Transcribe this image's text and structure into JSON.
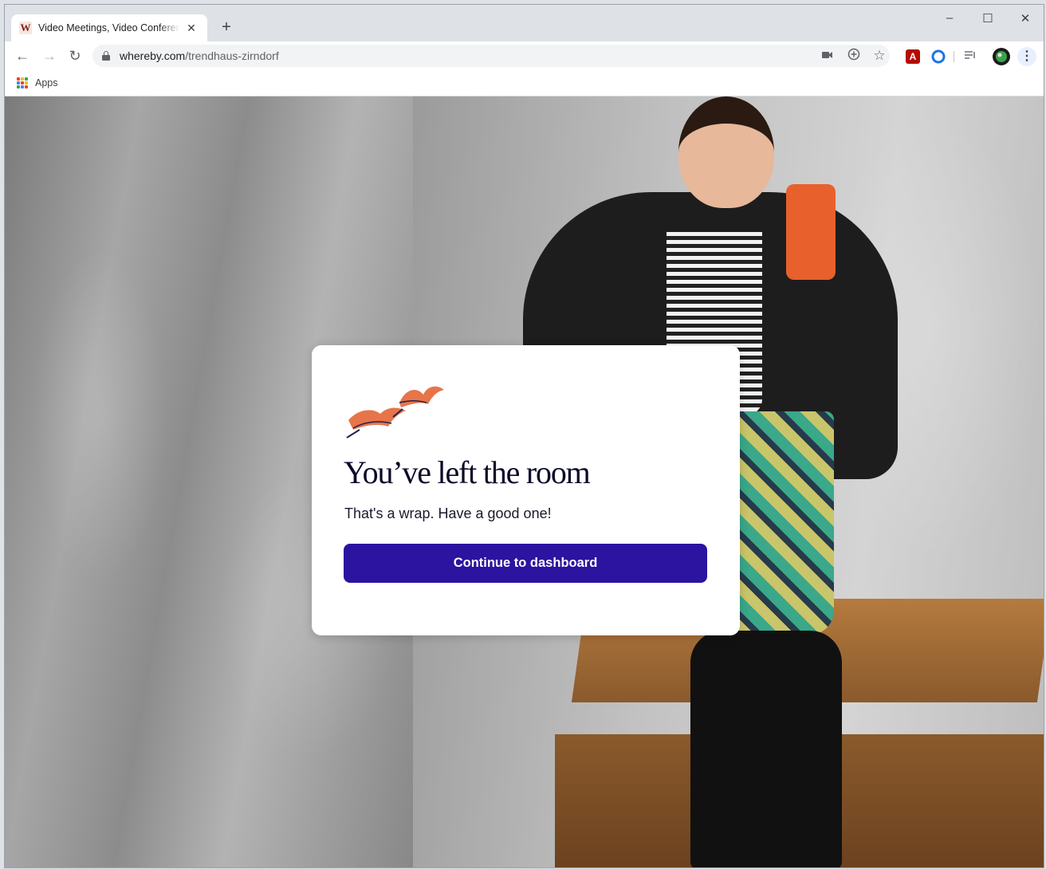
{
  "browser": {
    "tab": {
      "favicon_letter": "W",
      "title": "Video Meetings, Video Conferencing"
    },
    "address": {
      "host": "whereby.com",
      "path": "/trendhaus-zirndorf"
    },
    "bookmarks": {
      "apps_label": "Apps"
    }
  },
  "card": {
    "title": "You’ve left the room",
    "subtitle": "That's a wrap. Have a good one!",
    "cta_label": "Continue to dashboard"
  },
  "colors": {
    "cta_background": "#2c13a0",
    "title_text": "#0b0a27",
    "bird_orange": "#e8744a"
  }
}
